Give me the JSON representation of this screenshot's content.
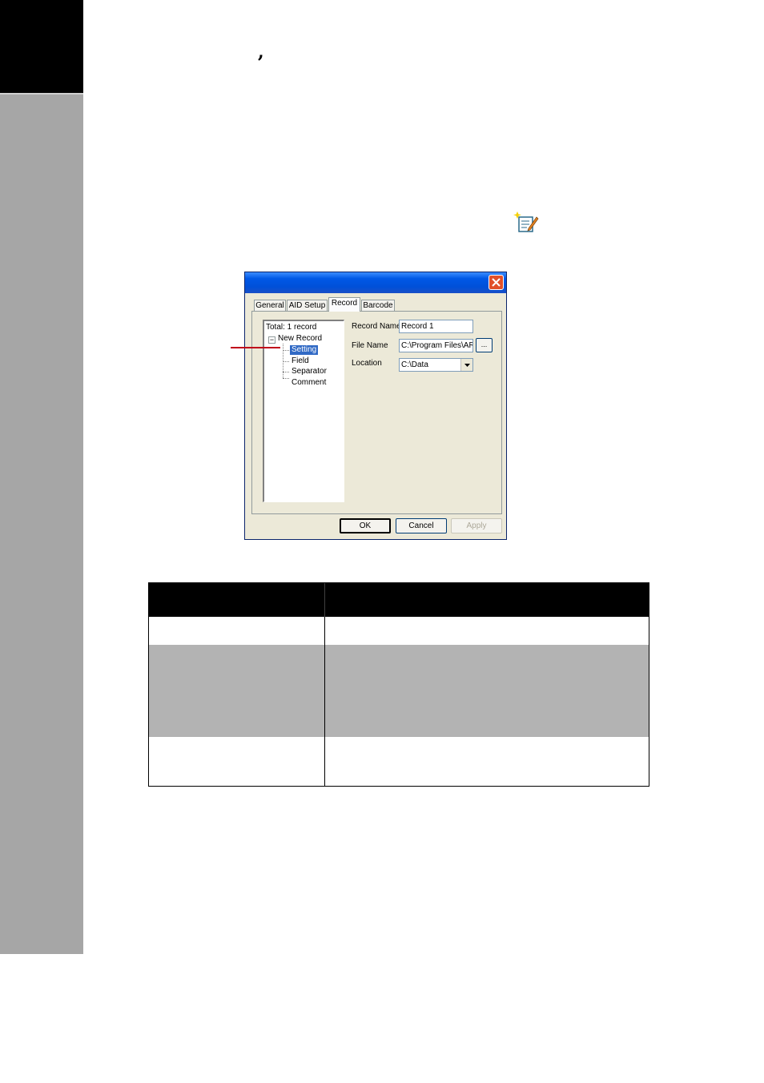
{
  "page": {
    "punctuation": ","
  },
  "dialog": {
    "tabs": [
      "General",
      "AID Setup",
      "Record",
      "Barcode"
    ],
    "active_tab": "Record",
    "tree": {
      "total": "Total:  1 record",
      "root": "New Record",
      "toggle": "−",
      "children": [
        "Setting",
        "Field",
        "Separator",
        "Comment"
      ],
      "selected": "Setting"
    },
    "record_name_label": "Record Name",
    "record_name_value": "Record 1",
    "file_name_label": "File Name",
    "file_name_value": "C:\\Program Files\\ARG",
    "browse_label": "...",
    "location_label": "Location",
    "location_value": "C:\\Data",
    "buttons": {
      "ok": "OK",
      "cancel": "Cancel",
      "apply": "Apply"
    }
  },
  "colors": {
    "header_row": "#000000",
    "shaded_row": "#b3b3b3",
    "pointer": "#c0001a",
    "selection": "#316ac5"
  },
  "icons": [
    "new-record-icon",
    "close-icon",
    "dropdown-arrow-icon"
  ]
}
